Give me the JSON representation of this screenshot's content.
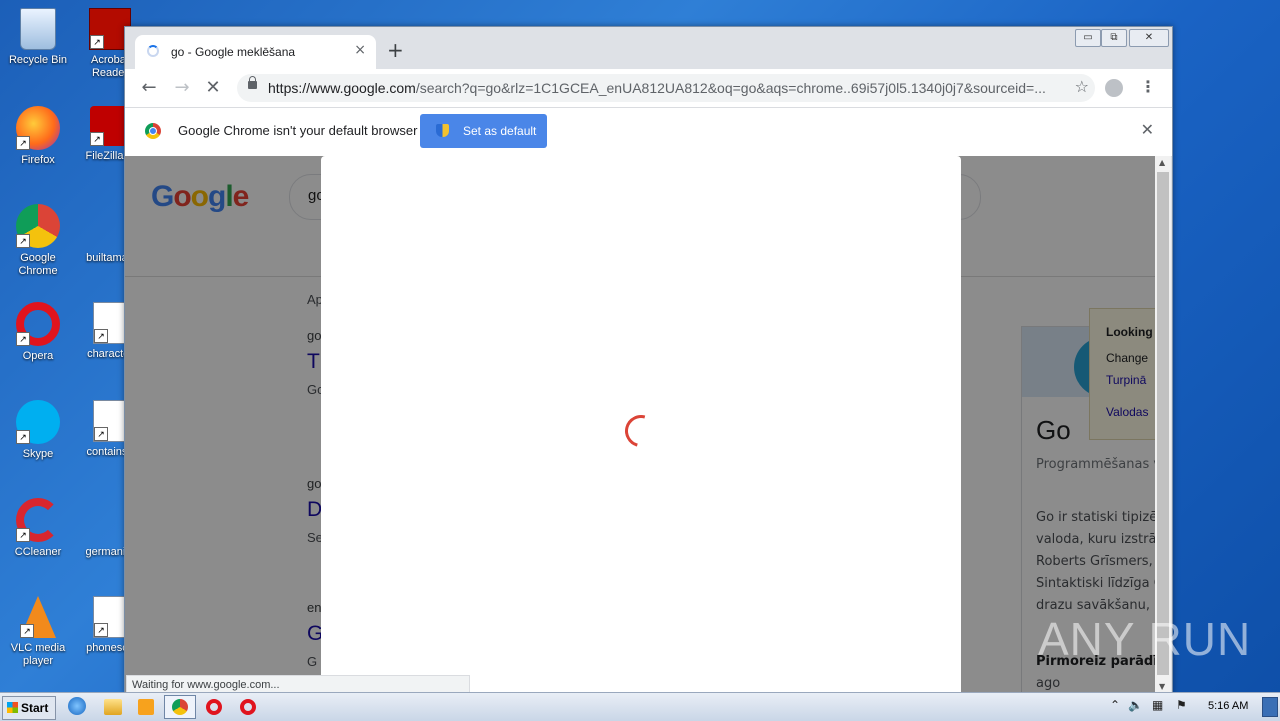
{
  "desktop": {
    "icons": [
      {
        "label": "Recycle Bin"
      },
      {
        "label": "Acrobat Reader"
      },
      {
        "label": "Firefox"
      },
      {
        "label": "FileZilla C"
      },
      {
        "label": "Google Chrome"
      },
      {
        "label": "builtamab"
      },
      {
        "label": "Opera"
      },
      {
        "label": "character"
      },
      {
        "label": "Skype"
      },
      {
        "label": "containsp"
      },
      {
        "label": "CCleaner"
      },
      {
        "label": "germanint"
      },
      {
        "label": "VLC media player"
      },
      {
        "label": "phonescu"
      }
    ]
  },
  "browser": {
    "tab": {
      "title": "go - Google meklēšana",
      "close": "×"
    },
    "new_tab": "+",
    "window_controls": {
      "minimize": "▭",
      "maximize": "⧉",
      "close": "✕"
    },
    "url_host": "https://www.google.com",
    "url_rest": "/search?q=go&rlz=1C1GCEA_enUA812UA812&oq=go&aqs=chrome..69i57j0l5.1340j0j7&sourceid=...",
    "infobar": {
      "message": "Google Chrome isn't your default browser",
      "button": "Set as default",
      "close": "✕"
    },
    "status": "Waiting for www.google.com..."
  },
  "google_page": {
    "logo": "Google",
    "query": "go",
    "results": [
      {
        "cite": "go",
        "title": "T",
        "snippet": "Go"
      },
      {
        "cite": "go",
        "title": "D",
        "snippet": "Se"
      },
      {
        "cite": "en",
        "title": "G",
        "snippet": "G"
      }
    ],
    "tab_label": "Ap",
    "knowledge_panel": {
      "name": "Go",
      "subtitle": "Programmēšanas v",
      "description": "Go ir statiski tipizē valoda, kuru izstrā Roberts Grīsmers, Sintaktiski līdzīga C drazu savākšanu,",
      "first_label": "Pirmoreiz parādīj",
      "first_value": "ago"
    },
    "side_popup": {
      "title": "Looking",
      "line1": "Change",
      "line2": "Turpinā",
      "line3": "Valodas"
    }
  },
  "watermark": "ANY RUN",
  "taskbar": {
    "start": "Start",
    "clock": "5:16 AM"
  },
  "colors": {
    "accent": "#4a86e8",
    "spinner": "#db4437",
    "link": "#1a0dab"
  }
}
